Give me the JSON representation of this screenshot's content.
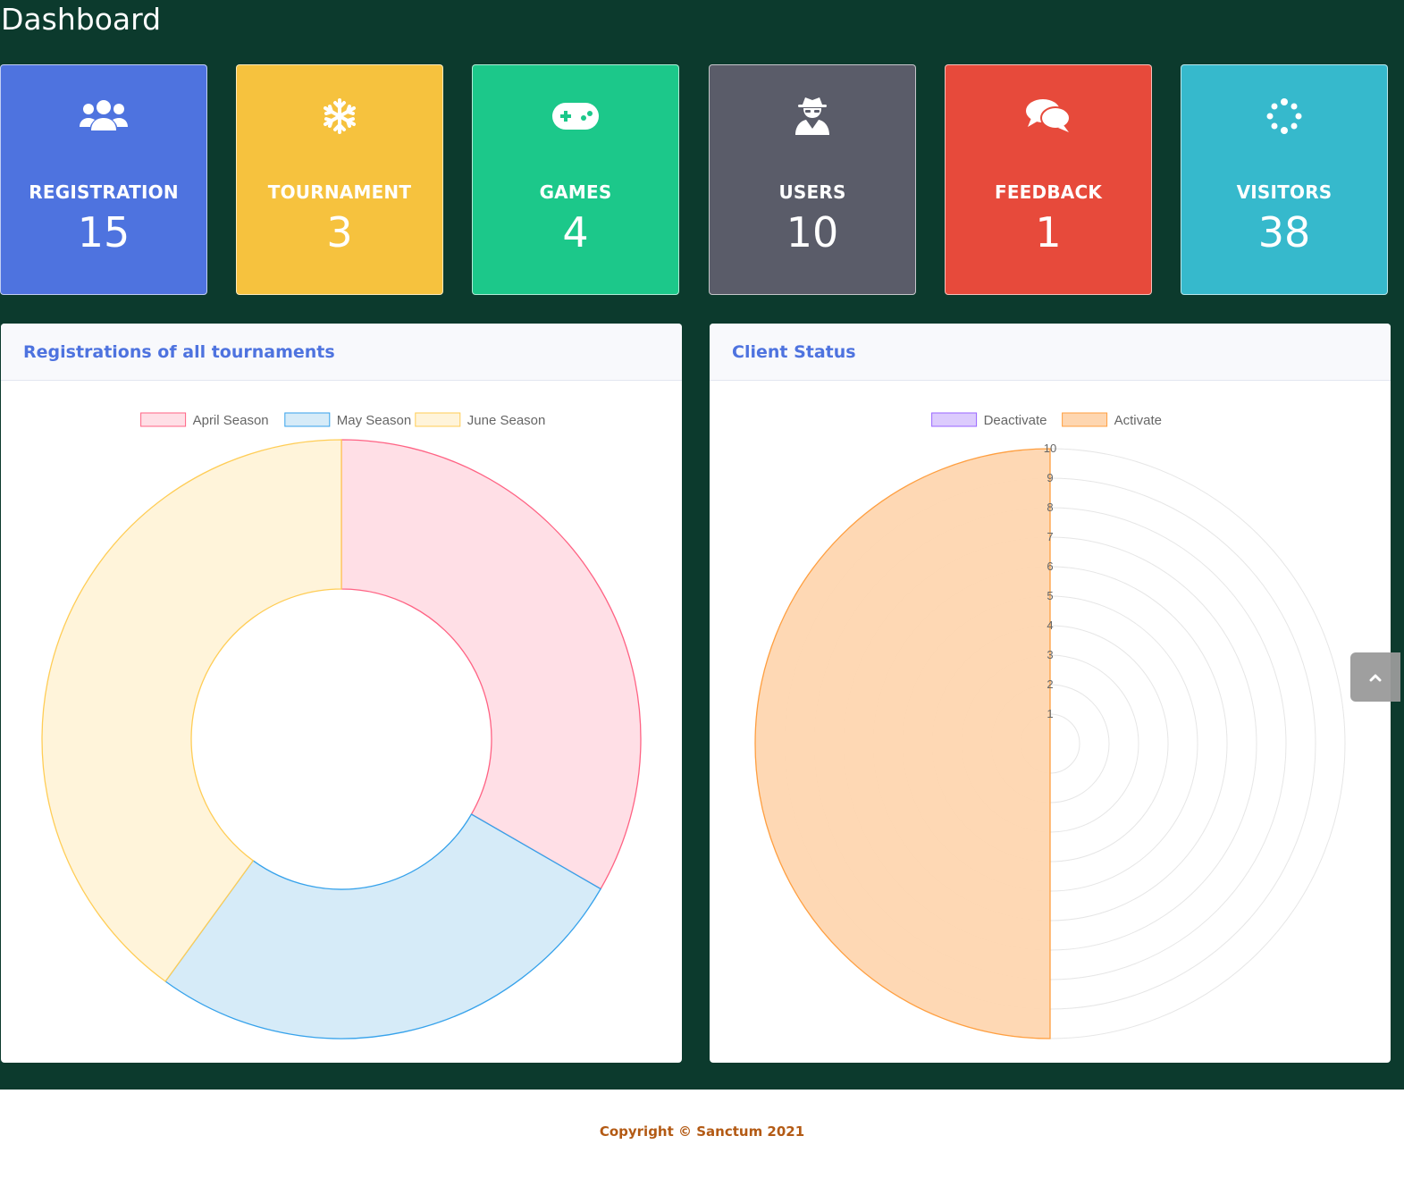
{
  "page": {
    "title": "Dashboard"
  },
  "stats": [
    {
      "key": "registration",
      "label": "REGISTRATION",
      "value": "15",
      "color": "#4e73df",
      "icon": "users-icon"
    },
    {
      "key": "tournament",
      "label": "TOURNAMENT",
      "value": "3",
      "color": "#f6c23e",
      "icon": "snowflake-icon"
    },
    {
      "key": "games",
      "label": "GAMES",
      "value": "4",
      "color": "#1cc88a",
      "icon": "gamepad-icon"
    },
    {
      "key": "users",
      "label": "USERS",
      "value": "10",
      "color": "#5a5c69",
      "icon": "user-secret-icon"
    },
    {
      "key": "feedback",
      "label": "FEEDBACK",
      "value": "1",
      "color": "#e74a3b",
      "icon": "comments-icon"
    },
    {
      "key": "visitors",
      "label": "VISITORS",
      "value": "38",
      "color": "#36b9cc",
      "icon": "spinner-icon"
    }
  ],
  "panels": {
    "registrations": {
      "title": "Registrations of all tournaments"
    },
    "client_status": {
      "title": "Client Status"
    }
  },
  "chart_data": [
    {
      "type": "doughnut",
      "title": "Registrations of all tournaments",
      "labels": [
        "April Season",
        "May Season",
        "June Season"
      ],
      "values": [
        5,
        4,
        6
      ],
      "colors": {
        "fill": [
          "#ffdfe6",
          "#d6ebf8",
          "#fff4da"
        ],
        "border": [
          "#ff6384",
          "#36a2eb",
          "#ffcd56"
        ]
      },
      "legend": "top"
    },
    {
      "type": "polarArea",
      "title": "Client Status",
      "labels": [
        "Deactivate",
        "Activate"
      ],
      "values": [
        0,
        10
      ],
      "r_ticks": [
        "1",
        "2",
        "3",
        "4",
        "5",
        "6",
        "7",
        "8",
        "9",
        "10"
      ],
      "r_range": [
        0,
        10
      ],
      "colors": {
        "fill": [
          "#dccbfd",
          "#fed6b0"
        ],
        "border": [
          "#9966ff",
          "#ff9f40"
        ]
      },
      "legend": "top"
    }
  ],
  "footer": {
    "copyright": "Copyright © Sanctum 2021"
  }
}
